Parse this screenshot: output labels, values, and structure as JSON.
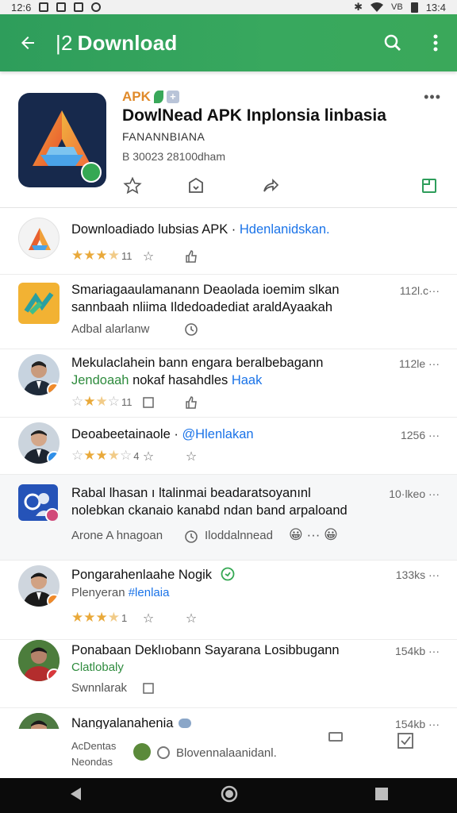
{
  "status_bar": {
    "time_left": "12:6",
    "time_right": "13:4",
    "signal_text": "VB"
  },
  "app_bar": {
    "title_prefix": "|2",
    "title": "Download"
  },
  "hero": {
    "tag": "APK",
    "plus": "+",
    "title": "DowlNead APK Inplonsia linbasia",
    "subtitle": "FANANNBIANA",
    "meta": "B 30023 28100dham",
    "menu": "•••"
  },
  "rows": [
    {
      "title": "Downloadiado lubsias APK · ",
      "title_link": "Hdenlanidskan.",
      "stars": 3.5,
      "count": "11"
    },
    {
      "title": "Smariagaaulamanann Deaolada ioemim slkan",
      "title2": "sannbaah nliima  Ildedoadediat araldAyaakah",
      "meta": "112l.c···",
      "sub": "Adbal alarlanw"
    },
    {
      "title": "Mekulaclahein bann engara beralbebagann",
      "title2_green": "Jendoaah",
      "title2_rest": " nokaf hasahdles ",
      "title2_link": "Haak",
      "meta": "112le ···",
      "stars": 2.5,
      "count": "11"
    },
    {
      "title": "Deoabeetainaole · ",
      "title_link": "@Hlenlakan",
      "meta": "1256 ···",
      "stars": 3.5,
      "count": "4"
    },
    {
      "title": "Rabal lhasan ı ltalinmai beadaratsoyanınl",
      "title2": "nolebkan ckanaio kanabd ndan band arpaloand",
      "meta": "10·lkeo ···",
      "sub": "Arone A hnagoan",
      "sub2": "Iloddalnnead",
      "emoji": "😀 ··· 😀"
    },
    {
      "title": "Pongarahenlaahe Nogik",
      "meta": "133ks ···",
      "sub": "Plenyeran ",
      "sub_link": "#lenlaia",
      "stars": 3.5,
      "count": "1"
    },
    {
      "title": "Ponabaan Deklıobann Sayarana Losibbugann",
      "meta": "154kb ···",
      "sub_green": "Clatlobaly",
      "sub": "Swnnlarak"
    },
    {
      "title": "Nangyalanahenia",
      "meta": "154kb ···",
      "sub": "AcDentas",
      "sub2": "Neondas"
    }
  ],
  "bottom": {
    "search_placeholder": "Blovennalaanidanl."
  },
  "colors": {
    "accent_green": "#2e9d5b",
    "link_blue": "#1a73e8",
    "star_gold": "#e9a93a"
  }
}
